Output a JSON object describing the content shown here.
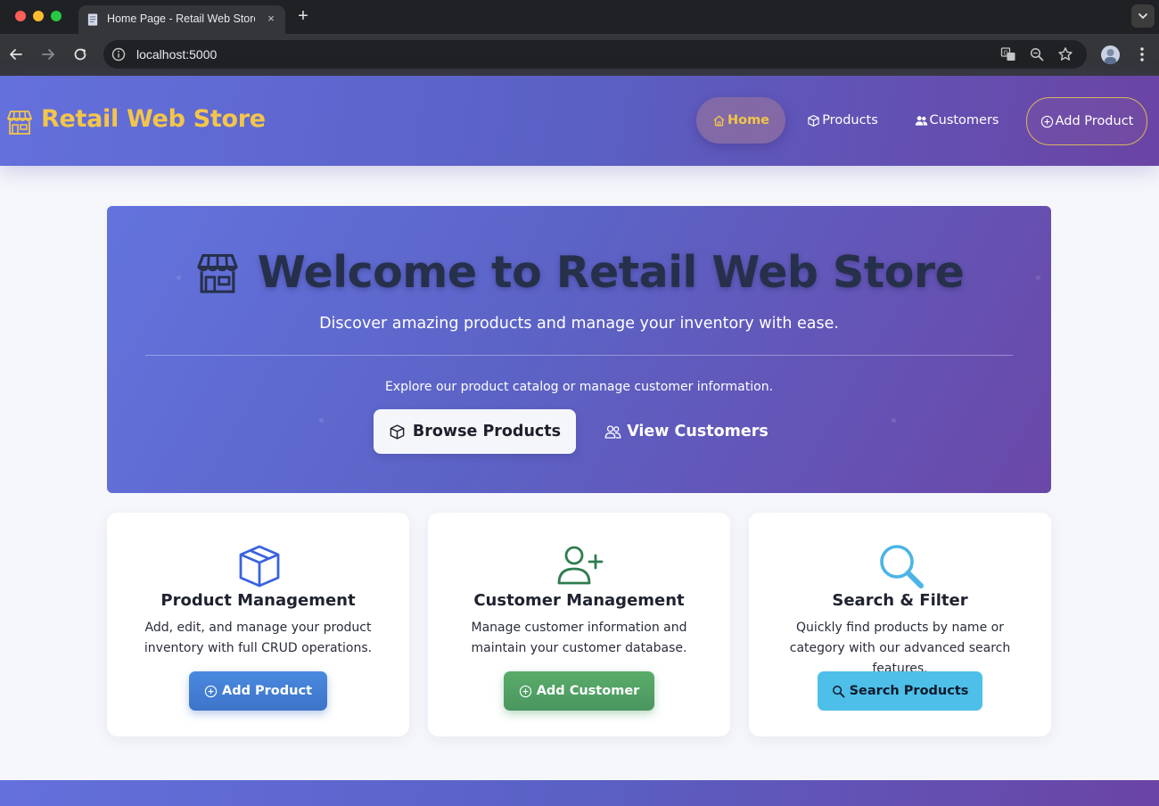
{
  "browser": {
    "tab_title": "Home Page - Retail Web Store",
    "tab_close": "×",
    "new_tab": "+",
    "url": "localhost:5000"
  },
  "header": {
    "brand_icon": "storefront-icon",
    "brand_name": "Retail Web Store",
    "nav": [
      {
        "label": "Home",
        "icon": "house-icon",
        "active": true
      },
      {
        "label": "Products",
        "icon": "box-icon"
      },
      {
        "label": "Customers",
        "icon": "people-icon"
      },
      {
        "label": "Add Product",
        "icon": "plus-circle-icon"
      }
    ]
  },
  "hero": {
    "title": "Welcome to Retail Web Store",
    "subtitle": "Discover amazing products and manage your inventory with ease.",
    "explore_text": "Explore our product catalog or manage customer information.",
    "browse_label": "Browse Products",
    "customers_label": "View Customers"
  },
  "cards": [
    {
      "icon": "box-icon",
      "title": "Product Management",
      "description": "Add, edit, and manage your product inventory with full CRUD operations.",
      "button": "Add Product"
    },
    {
      "icon": "person-plus-icon",
      "title": "Customer Management",
      "description": "Manage customer information and maintain your customer database.",
      "button": "Add Customer"
    },
    {
      "icon": "search-icon",
      "title": "Search & Filter",
      "description": "Quickly find products by name or category with our advanced search features.",
      "button": "Search Products"
    }
  ],
  "colors": {
    "brand_gold": "#f3c54a",
    "gradient_start": "#6470dc",
    "gradient_end": "#6a44a4",
    "btn_blue": "#3d74c8",
    "btn_green": "#4a9660",
    "btn_cyan": "#4dbfe9",
    "icon_blue": "#3a62e0",
    "icon_green": "#2f7d4f",
    "icon_cyan": "#4bb4e6"
  }
}
